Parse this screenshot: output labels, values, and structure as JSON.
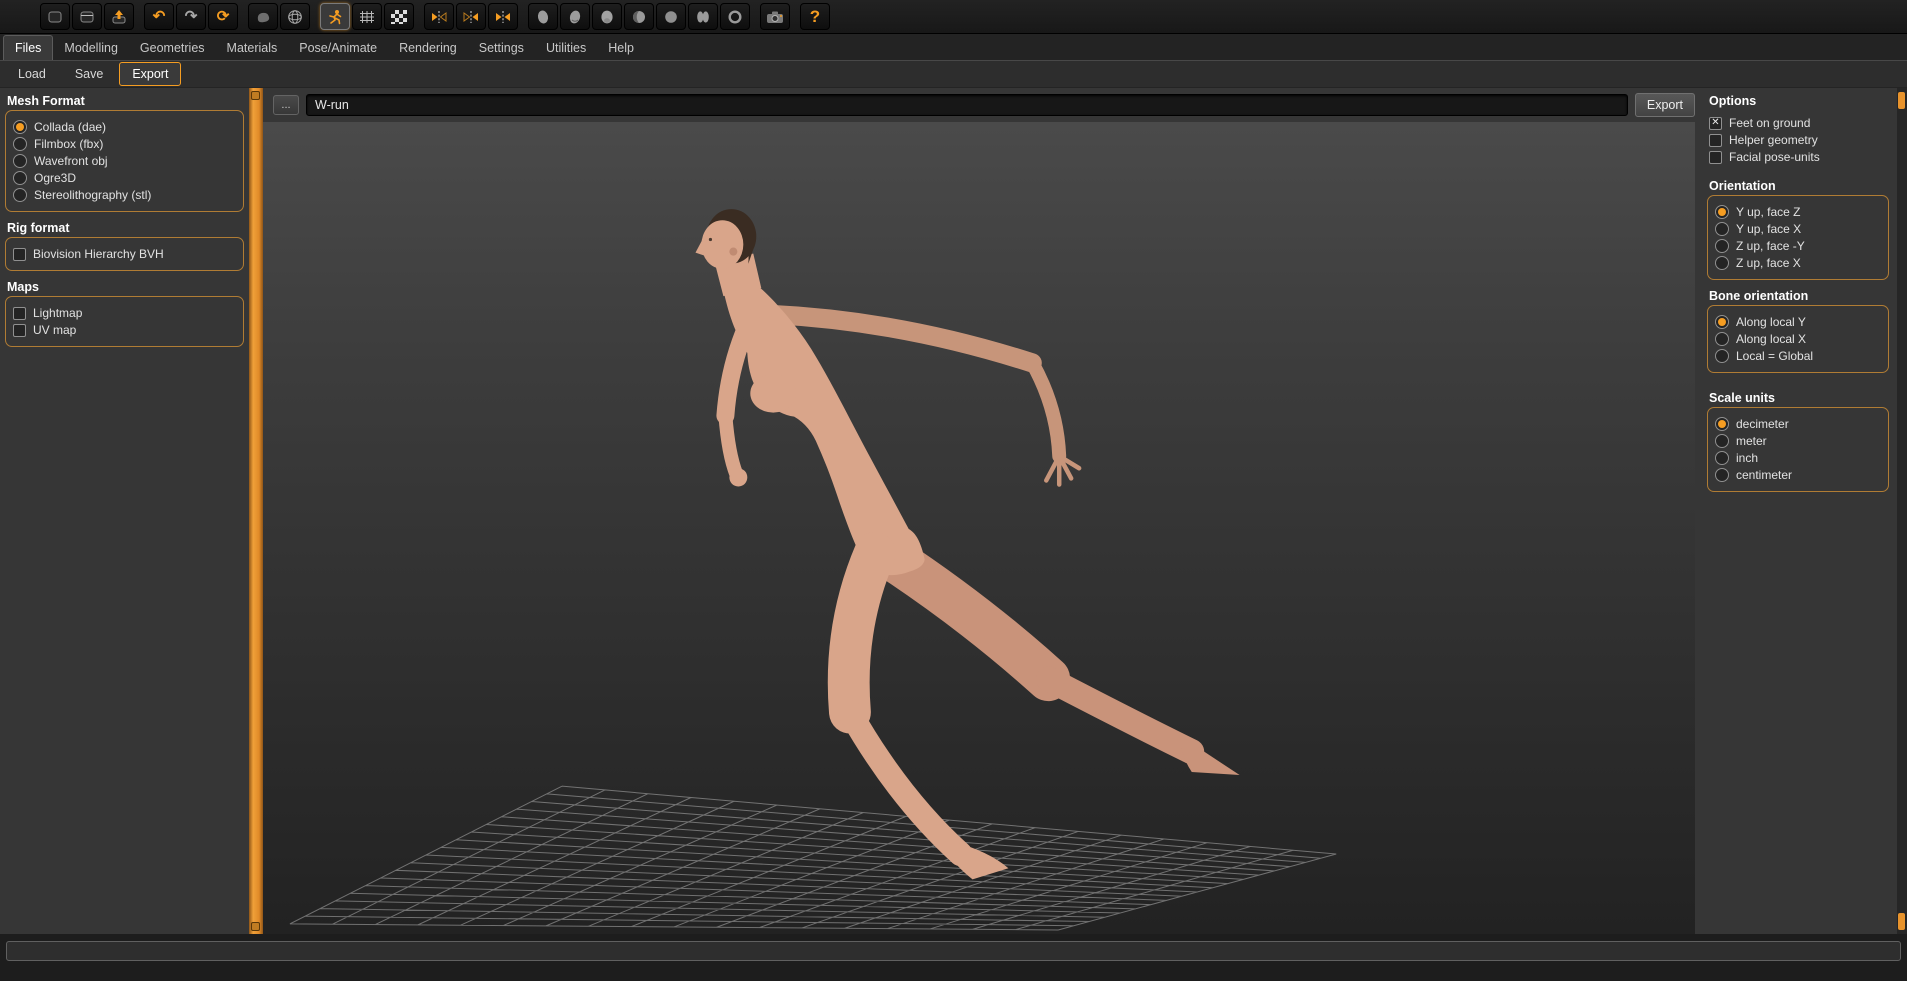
{
  "toolbar": {
    "undo_glyph": "↶",
    "redo_glyph": "↷",
    "reload_glyph": "⟳",
    "help_glyph": "?",
    "icon_names": [
      "new-document",
      "load-document",
      "save-document",
      "undo",
      "redo",
      "reload",
      "smooth-mesh",
      "wireframe-globe",
      "pose-runner",
      "wire-grid",
      "uv-checker",
      "symmetry-right",
      "symmetry-left",
      "symmetry-both",
      "view-head-side",
      "view-head-tilt",
      "view-head-front",
      "view-head-shaded",
      "view-head-back",
      "view-body-lobes",
      "view-orbit-ring",
      "grab-screenshot",
      "help"
    ],
    "active_icon": "pose-runner"
  },
  "tabs": {
    "active": "Files",
    "items": [
      "Files",
      "Modelling",
      "Geometries",
      "Materials",
      "Pose/Animate",
      "Rendering",
      "Settings",
      "Utilities",
      "Help"
    ]
  },
  "subtabs": {
    "active": "Export",
    "items": [
      "Load",
      "Save",
      "Export"
    ]
  },
  "left_panel": {
    "mesh_format": {
      "title": "Mesh Format",
      "type": "radio",
      "options": [
        {
          "label": "Collada (dae)",
          "selected": true
        },
        {
          "label": "Filmbox (fbx)",
          "selected": false
        },
        {
          "label": "Wavefront obj",
          "selected": false
        },
        {
          "label": "Ogre3D",
          "selected": false
        },
        {
          "label": "Stereolithography (stl)",
          "selected": false
        }
      ]
    },
    "rig_format": {
      "title": "Rig format",
      "type": "checkbox",
      "options": [
        {
          "label": "Biovision Hierarchy BVH",
          "checked": false
        }
      ]
    },
    "maps": {
      "title": "Maps",
      "type": "checkbox",
      "options": [
        {
          "label": "Lightmap",
          "checked": false
        },
        {
          "label": "UV map",
          "checked": false
        }
      ]
    }
  },
  "export_bar": {
    "browse_label": "...",
    "filename": "W-run",
    "export_label": "Export"
  },
  "right_panel": {
    "options": {
      "title": "Options",
      "items": [
        {
          "label": "Feet on ground",
          "checked": true
        },
        {
          "label": "Helper geometry",
          "checked": false
        },
        {
          "label": "Facial pose-units",
          "checked": false
        }
      ]
    },
    "orientation": {
      "title": "Orientation",
      "options": [
        {
          "label": "Y up, face Z",
          "selected": true
        },
        {
          "label": "Y up, face X",
          "selected": false
        },
        {
          "label": "Z up, face -Y",
          "selected": false
        },
        {
          "label": "Z up, face X",
          "selected": false
        }
      ]
    },
    "bone_orientation": {
      "title": "Bone orientation",
      "options": [
        {
          "label": "Along local Y",
          "selected": true
        },
        {
          "label": "Along local X",
          "selected": false
        },
        {
          "label": "Local = Global",
          "selected": false
        }
      ]
    },
    "scale_units": {
      "title": "Scale units",
      "options": [
        {
          "label": "decimeter",
          "selected": true
        },
        {
          "label": "meter",
          "selected": false
        },
        {
          "label": "inch",
          "selected": false
        },
        {
          "label": "centimeter",
          "selected": false
        }
      ]
    }
  },
  "viewport": {
    "scene": "Nude female 3D figure in running pose above a wireframe ground grid",
    "figure_skin_color": "#d9a58a",
    "figure_shadow_color": "#c7957a",
    "hair_color": "#3a2c22",
    "grid_color": "#bdbdbd"
  },
  "colors": {
    "accent_orange": "#f59d22",
    "group_border": "#b07c34",
    "splitter_orange": "#e8932c",
    "background": "#363636",
    "viewport_top": "#4a4a4a",
    "viewport_bottom": "#222222"
  }
}
